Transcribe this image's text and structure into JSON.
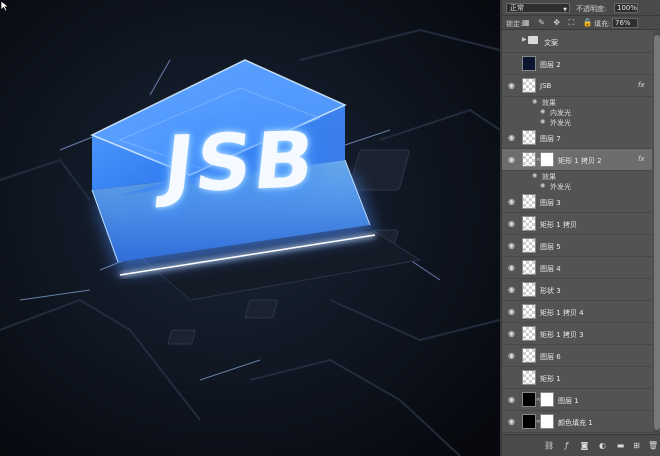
{
  "canvas": {
    "chip_text": "JSB"
  },
  "layers_panel": {
    "blend_mode": "正常",
    "opacity_label": "不透明度:",
    "opacity_value": "100%",
    "lock_label": "锁定:",
    "fill_label": "填充:",
    "fill_value": "76%",
    "layers": [
      {
        "type": "group",
        "name": "文案",
        "visible": false
      },
      {
        "type": "layer",
        "name": "图层 2",
        "thumb": "blue",
        "visible": false
      },
      {
        "type": "layer",
        "name": "JSB",
        "thumb": "checker",
        "fx": "fx",
        "visible": true
      },
      {
        "type": "effects",
        "label": "效果"
      },
      {
        "type": "effect",
        "label": "内发光"
      },
      {
        "type": "effect",
        "label": "外发光"
      },
      {
        "type": "layer",
        "name": "图层 7",
        "thumb": "checker",
        "visible": true
      },
      {
        "type": "layer",
        "name": "矩形 1 拷贝 2",
        "thumb": "checker",
        "mask": true,
        "fx": "fx",
        "selected": true,
        "visible": true
      },
      {
        "type": "effects",
        "label": "效果"
      },
      {
        "type": "effect",
        "label": "外发光"
      },
      {
        "type": "layer",
        "name": "图层 3",
        "thumb": "checker",
        "visible": true
      },
      {
        "type": "layer",
        "name": "矩形 1 拷贝",
        "thumb": "checker",
        "visible": true
      },
      {
        "type": "layer",
        "name": "图层 5",
        "thumb": "checker",
        "visible": true
      },
      {
        "type": "layer",
        "name": "图层 4",
        "thumb": "checker",
        "visible": true
      },
      {
        "type": "layer",
        "name": "形状 3",
        "thumb": "checker",
        "visible": true
      },
      {
        "type": "layer",
        "name": "矩形 1 拷贝 4",
        "thumb": "checker",
        "visible": true
      },
      {
        "type": "layer",
        "name": "矩形 1 拷贝 3",
        "thumb": "checker",
        "visible": true
      },
      {
        "type": "layer",
        "name": "图层 6",
        "thumb": "checker",
        "visible": true
      },
      {
        "type": "layer",
        "name": "矩形 1",
        "thumb": "checker",
        "visible": false
      },
      {
        "type": "layer",
        "name": "图层 1",
        "thumb": "black",
        "mask": true,
        "visible": true
      },
      {
        "type": "layer",
        "name": "颜色填充 1",
        "thumb": "black",
        "mask": true,
        "visible": true
      }
    ]
  }
}
